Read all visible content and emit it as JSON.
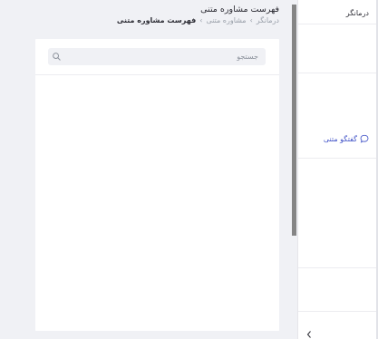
{
  "header": {
    "page_title": "فهرست مشاوره متنی",
    "breadcrumb": [
      {
        "label": "درمانگر"
      },
      {
        "label": "مشاوره متنی"
      },
      {
        "label": "فهرست مشاوره متنی"
      }
    ],
    "breadcrumb_separator": "›"
  },
  "search": {
    "placeholder": "جستجو",
    "value": ""
  },
  "sidebar": {
    "header": "درمانگر",
    "items": [
      {
        "label": "گفتگو متنی",
        "icon": "chat-icon",
        "active": true
      }
    ]
  },
  "colors": {
    "accent": "#3f51c7",
    "background": "#f0f1f5",
    "card": "#ffffff"
  }
}
